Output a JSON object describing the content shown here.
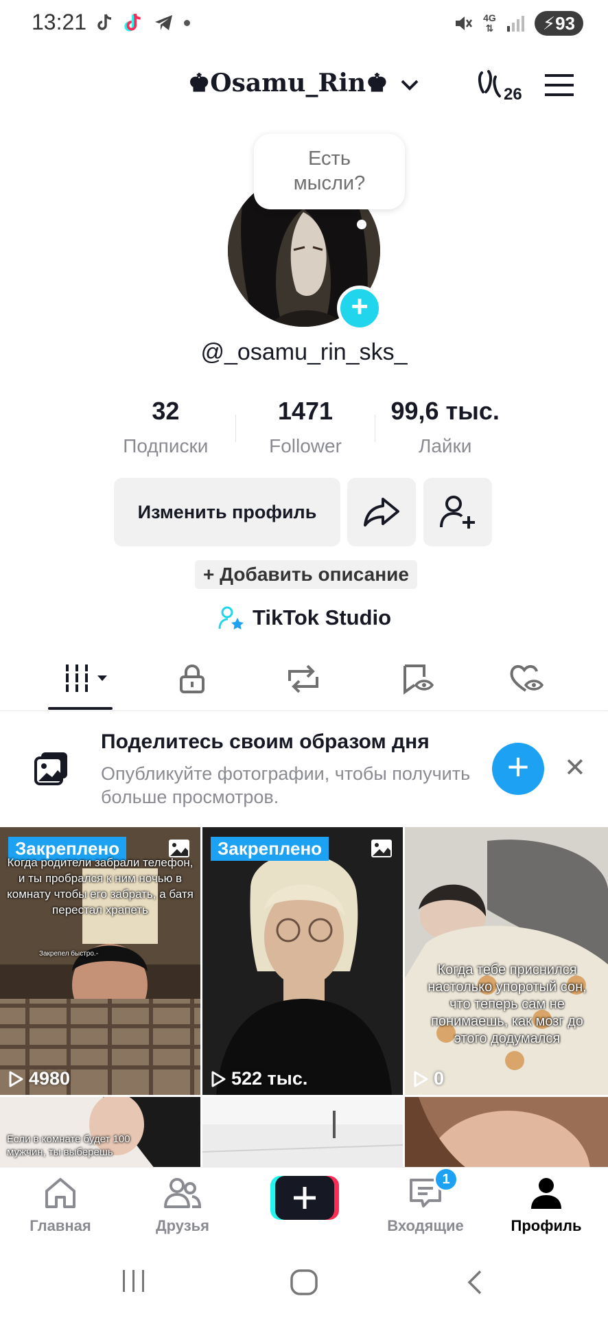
{
  "status_bar": {
    "time": "13:21",
    "network": "4G",
    "battery": "93"
  },
  "header": {
    "title": "♚Osamu_Rin♚",
    "streak_count": "26"
  },
  "profile": {
    "bubble_text_1": "Есть",
    "bubble_text_2": "мысли?",
    "handle": "@_osamu_rin_sks_",
    "stats": [
      {
        "value": "32",
        "label": "Подписки"
      },
      {
        "value": "1471",
        "label": "Follower"
      },
      {
        "value": "99,6 тыс.",
        "label": "Лайки"
      }
    ],
    "edit_button": "Изменить профиль",
    "add_description": "+ Добавить описание",
    "studio_link": "TikTok Studio"
  },
  "tabs": [
    "videos-grid",
    "private",
    "reposts",
    "favorites",
    "liked"
  ],
  "banner": {
    "title": "Поделитесь своим образом дня",
    "subtitle": "Опубликуйте фотографии, чтобы получить больше просмотров."
  },
  "videos": [
    {
      "pinned": "Закреплено",
      "caption": "Когда родители забрали телефон, и ты пробрался к ним ночью в комнату чтобы его забрать, а батя перестал храпеть",
      "subcaption": "Закрепел быстро.-",
      "views": "4980"
    },
    {
      "pinned": "Закреплено",
      "caption": "",
      "views": "522 тыс."
    },
    {
      "pinned": "",
      "caption": "Когда тебе приснился настолько упоротый сон, что теперь сам не понимаешь, как мозг до этого додумался",
      "views": "0"
    },
    {
      "caption": "Если в комнате будет 100 мужчин, ты выберешь"
    },
    {
      "caption": ""
    },
    {
      "caption": ""
    }
  ],
  "bottom_nav": {
    "home": "Главная",
    "friends": "Друзья",
    "inbox": "Входящие",
    "inbox_badge": "1",
    "profile": "Профиль"
  },
  "colors": {
    "accent_blue": "#1da1f2",
    "cyan": "#20d5ec",
    "tiktok_red": "#fe2c55"
  }
}
